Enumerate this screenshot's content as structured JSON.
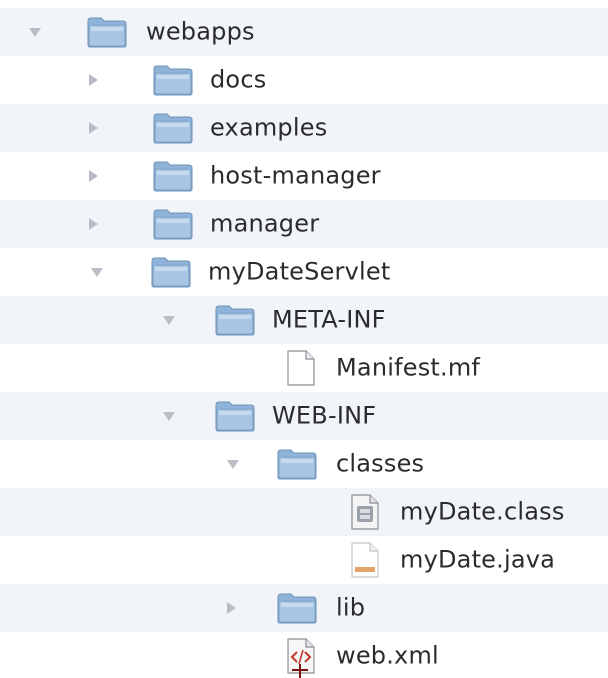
{
  "tree": {
    "rows": [
      {
        "label": "webapps",
        "type": "folder",
        "expanded": true
      },
      {
        "label": "docs",
        "type": "folder",
        "expanded": false
      },
      {
        "label": "examples",
        "type": "folder",
        "expanded": false
      },
      {
        "label": "host-manager",
        "type": "folder",
        "expanded": false
      },
      {
        "label": "manager",
        "type": "folder",
        "expanded": false
      },
      {
        "label": "myDateServlet",
        "type": "folder",
        "expanded": true
      },
      {
        "label": "META-INF",
        "type": "folder",
        "expanded": true
      },
      {
        "label": "Manifest.mf",
        "type": "file-text"
      },
      {
        "label": "WEB-INF",
        "type": "folder",
        "expanded": true
      },
      {
        "label": "classes",
        "type": "folder",
        "expanded": true
      },
      {
        "label": "myDate.class",
        "type": "file-class"
      },
      {
        "label": "myDate.java",
        "type": "file-java"
      },
      {
        "label": "lib",
        "type": "folder",
        "expanded": false
      },
      {
        "label": "web.xml",
        "type": "file-xml"
      }
    ]
  },
  "colors": {
    "stripe": "#f1f4f9",
    "folder_body": "#a8c6e4",
    "folder_tab": "#8fb3d8",
    "arrow": "#b9bec6",
    "text": "#2b2b2b"
  },
  "icons": {
    "folder": "folder-icon",
    "file_text": "text-file-icon",
    "file_class": "class-file-icon",
    "file_java": "java-file-icon",
    "file_xml": "xml-file-icon",
    "collapsed": "disclosure-collapsed-icon",
    "expanded": "disclosure-expanded-icon",
    "cursor": "text-cursor-icon"
  }
}
